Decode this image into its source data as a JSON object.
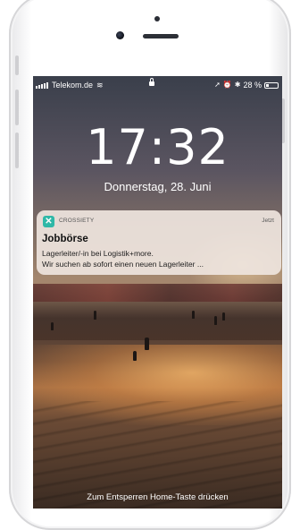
{
  "status_bar": {
    "carrier": "Telekom.de",
    "right_text": "28 %",
    "battery_level": 0.28
  },
  "lockscreen": {
    "time": "17:32",
    "date": "Donnerstag, 28. Juni",
    "unlock_hint": "Zum Entsperren Home-Taste drücken"
  },
  "notification": {
    "app_name": "CROSSIETY",
    "time": "Jetzt",
    "title": "Jobbörse",
    "line1": "Lagerleiter/-in bei Logistik+more.",
    "line2": "Wir suchen ab sofort einen neuen Lagerleiter ..."
  },
  "colors": {
    "app_accent": "#2fb8a7"
  }
}
